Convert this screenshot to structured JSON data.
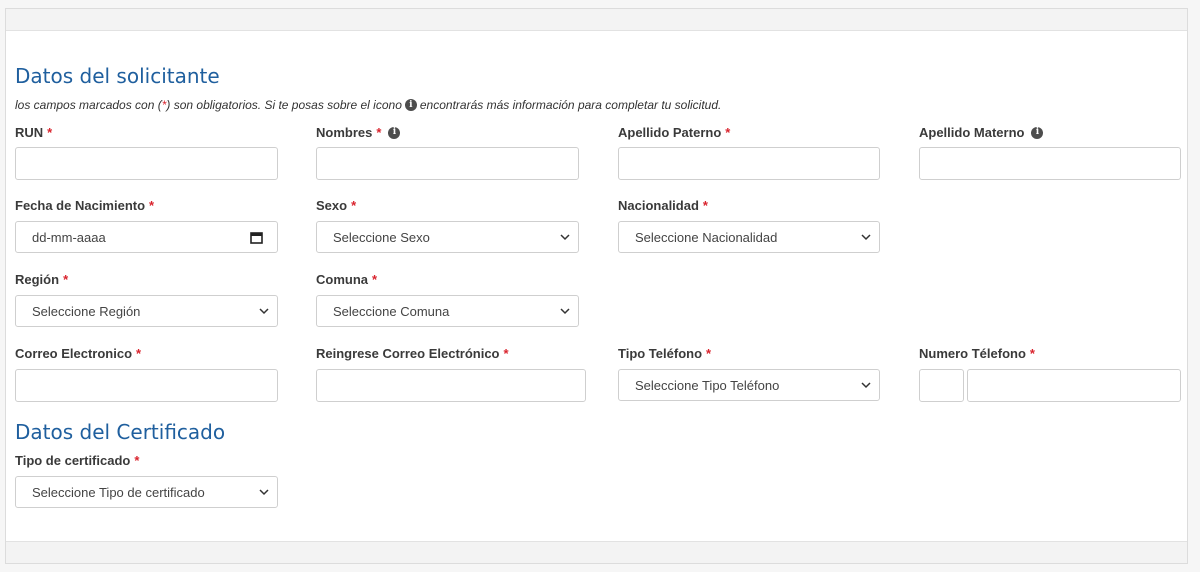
{
  "applicant": {
    "title": "Datos del solicitante",
    "note": {
      "part1": "los campos marcados con (",
      "star": "*",
      "part2": ") son obligatorios. Si te posas sobre el icono",
      "part3": "encontrarás más información para completar tu solicitud."
    },
    "info_glyph": "i",
    "required_mark": "*",
    "fields": {
      "run": {
        "label": "RUN"
      },
      "nombres": {
        "label": "Nombres"
      },
      "apellido_paterno": {
        "label": "Apellido Paterno"
      },
      "apellido_materno": {
        "label": "Apellido Materno"
      },
      "fecha_nacimiento": {
        "label": "Fecha de Nacimiento",
        "value": "dd-mm-aaaa"
      },
      "sexo": {
        "label": "Sexo",
        "value": "Seleccione Sexo"
      },
      "nacionalidad": {
        "label": "Nacionalidad",
        "value": "Seleccione Nacionalidad"
      },
      "region": {
        "label": "Región",
        "value": "Seleccione Región"
      },
      "comuna": {
        "label": "Comuna",
        "value": "Seleccione Comuna"
      },
      "correo": {
        "label": "Correo Electronico"
      },
      "reingrese_correo": {
        "label": "Reingrese Correo Electrónico"
      },
      "tipo_telefono": {
        "label": "Tipo Teléfono",
        "value": "Seleccione Tipo Teléfono"
      },
      "numero_telefono": {
        "label": "Numero Télefono"
      }
    }
  },
  "certificate": {
    "title": "Datos del Certificado",
    "fields": {
      "tipo_certificado": {
        "label": "Tipo de certificado",
        "value": "Seleccione Tipo de certificado"
      }
    }
  },
  "colors": {
    "title_blue": "#1f5f9e",
    "required_red": "#d9232d",
    "border": "#cfcfcf"
  }
}
